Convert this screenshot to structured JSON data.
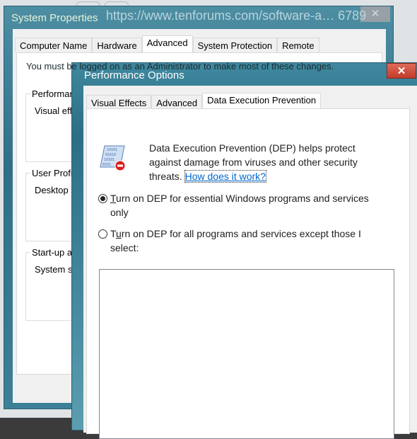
{
  "background": {
    "url_text": "https://www.tenforums.com/software-a",
    "url_tail": "6789"
  },
  "system_properties": {
    "title": "System Properties",
    "close": "✕",
    "tabs": [
      {
        "label": "Computer Name"
      },
      {
        "label": "Hardware"
      },
      {
        "label": "Advanced",
        "active": true
      },
      {
        "label": "System Protection"
      },
      {
        "label": "Remote"
      }
    ],
    "note": "You must be logged on as an Administrator to make most of these changes.",
    "groups": [
      {
        "label": "Performan",
        "text": "Visual effe"
      },
      {
        "label": "User Profil",
        "text": "Desktop s"
      },
      {
        "label": "Start-up an",
        "text": "System st"
      }
    ]
  },
  "performance_options": {
    "title": "Performance Options",
    "close": "✕",
    "tabs": [
      {
        "label": "Visual Effects"
      },
      {
        "label": "Advanced"
      },
      {
        "label": "Data Execution Prevention",
        "active": true
      }
    ],
    "icon": "dep-shield-icon",
    "description": "Data Execution Prevention (DEP) helps protect against damage from viruses and other security threats. ",
    "link": "How does it work?",
    "options": [
      {
        "pre": "",
        "key": "T",
        "post": "urn on DEP for essential Windows programs and services only",
        "selected": true
      },
      {
        "pre": "T",
        "key": "u",
        "post": "rn on DEP for all programs and services except those I select:",
        "selected": false
      }
    ]
  }
}
